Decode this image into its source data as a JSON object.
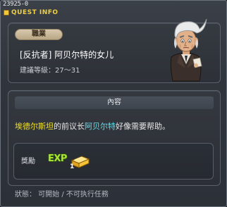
{
  "window": {
    "quest_id": "23925-0",
    "title": "QUEST INFO"
  },
  "quest": {
    "job_tag": "職業",
    "name": "[反抗者] 阿贝尔特的女儿",
    "level_range": "建議等級：27～31"
  },
  "content": {
    "header": "內容",
    "desc_name1": "埃德尔斯坦",
    "desc_text1": "的前议长",
    "desc_name2": "阿贝尔特",
    "desc_text2": "好像需要帮助。"
  },
  "reward": {
    "label": "獎勵",
    "exp_label": "EXP",
    "gold_count": "1"
  },
  "status": "狀態： 可開始 / 不可执行任務",
  "colors": {
    "highlight_place": "#f3e12a",
    "highlight_person": "#5fe0f0",
    "title_accent": "#f0d040",
    "exp_green": "#a9e636"
  },
  "icons": {
    "title": "quest-info-icon",
    "exp": "exp-icon",
    "gold": "gold-bar-icon",
    "npc": "npc-portrait"
  }
}
